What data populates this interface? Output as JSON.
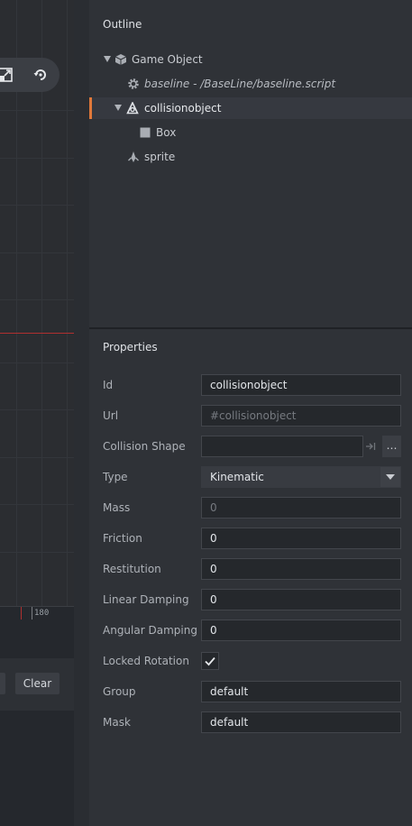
{
  "outline": {
    "title": "Outline",
    "items": [
      {
        "label": "Game Object"
      },
      {
        "label": "baseline - /BaseLine/baseline.script"
      },
      {
        "label": "collisionobject"
      },
      {
        "label": "Box"
      },
      {
        "label": "sprite"
      }
    ]
  },
  "properties": {
    "title": "Properties",
    "id": {
      "label": "Id",
      "value": "collisionobject"
    },
    "url": {
      "label": "Url",
      "value": "#collisionobject"
    },
    "collision_shape": {
      "label": "Collision Shape",
      "value": "",
      "browse_label": "…"
    },
    "type": {
      "label": "Type",
      "value": "Kinematic"
    },
    "mass": {
      "label": "Mass",
      "value": "0"
    },
    "friction": {
      "label": "Friction",
      "value": "0"
    },
    "restitution": {
      "label": "Restitution",
      "value": "0"
    },
    "linear_damping": {
      "label": "Linear Damping",
      "value": "0"
    },
    "angular_damping": {
      "label": "Angular Damping",
      "value": "0"
    },
    "locked_rotation": {
      "label": "Locked Rotation",
      "checked": true
    },
    "group": {
      "label": "Group",
      "value": "default"
    },
    "mask": {
      "label": "Mask",
      "value": "default"
    }
  },
  "editor": {
    "ruler_label": "180",
    "clear_label": "Clear"
  },
  "colors": {
    "selection_accent": "#e0783a",
    "axis_red": "#b03030"
  }
}
